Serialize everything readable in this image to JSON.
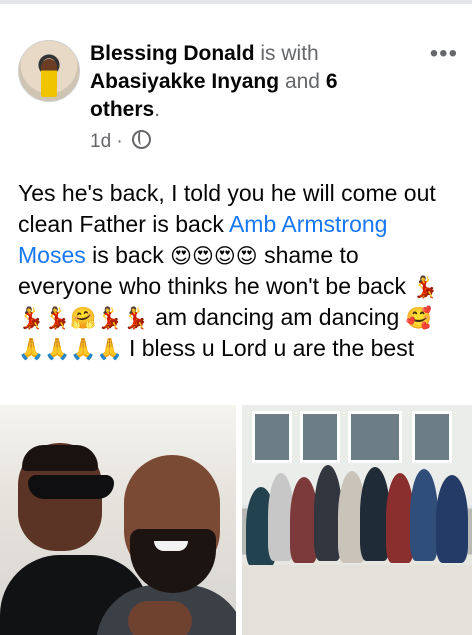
{
  "post": {
    "author": "Blessing Donald",
    "with_text": "is with",
    "tagged": "Abasiyakke Inyang",
    "and_text": "and",
    "others": "6 others",
    "period": ".",
    "time": "1d",
    "separator": "·",
    "audience_icon": "globe-icon",
    "more_icon": "more-options-icon",
    "text_parts": {
      "t1": "Yes he's back, I told you he will come out clean Father is back ",
      "mention": "Amb Armstrong Moses",
      "t2": "  is back ",
      "emoji1": "😍😍😍😍",
      "t3": " shame to everyone who thinks he won't be back ",
      "emoji2": "💃💃💃🤗💃💃",
      "t4": " am dancing am dancing ",
      "emoji3": "🥰🙏🙏🙏🙏",
      "t5": " I bless u Lord u are the best"
    }
  },
  "photos": [
    {
      "name": "photo-1"
    },
    {
      "name": "photo-2"
    }
  ]
}
